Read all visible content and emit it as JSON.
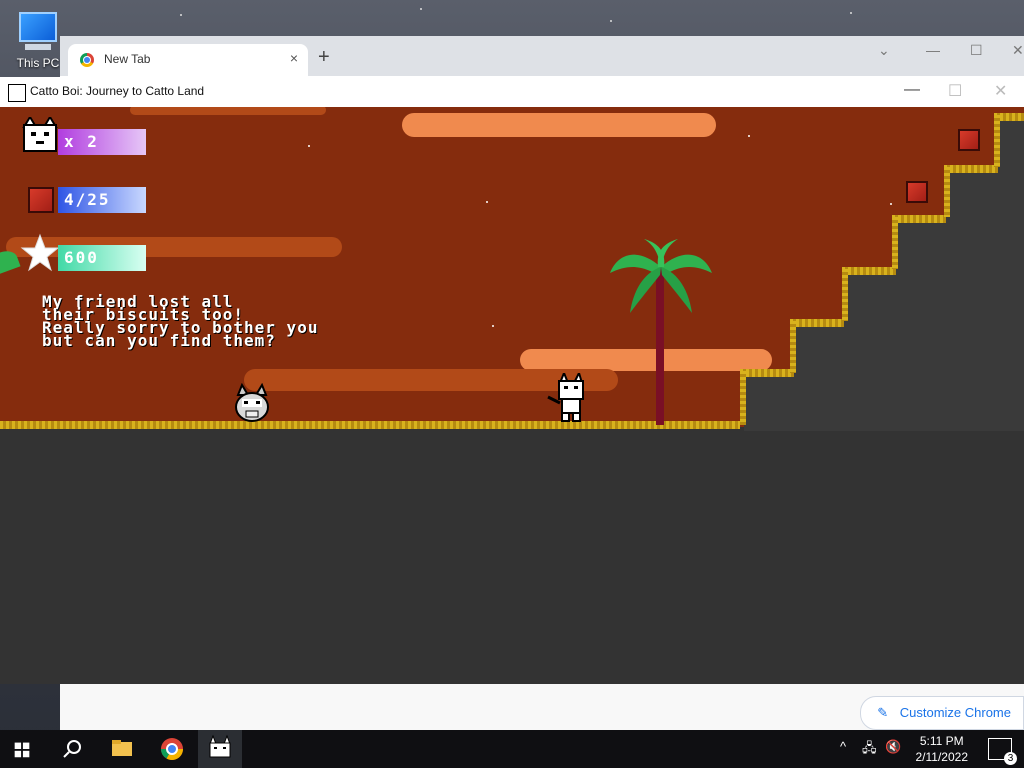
{
  "desktop": {
    "icon_label": "This PC"
  },
  "chrome": {
    "tab_title": "New Tab",
    "tab_close": "×",
    "new_tab": "+",
    "chevron": "⌄",
    "minimize": "—",
    "maximize": "☐",
    "close": "✕",
    "customize_label": "Customize Chrome"
  },
  "game_window": {
    "title": "Catto Boi: Journey to Catto Land",
    "minimize": "—",
    "maximize": "☐",
    "close": "✕"
  },
  "hud": {
    "lives": "x 2",
    "crates": "4/25",
    "score": "600"
  },
  "dialogue": {
    "lines": [
      "My friend lost all",
      "their biscuits too!",
      "Really sorry to bother you",
      "but can you find them?"
    ]
  },
  "taskbar": {
    "time": "5:11 PM",
    "date": "2/11/2022",
    "notifications": "3"
  },
  "colors": {
    "sky": "#852c0d",
    "ground_edge": "#d8b21d",
    "hud_lives": "#c86bf0",
    "hud_crates": "#3f63e6",
    "hud_score": "#6ff0c0"
  }
}
